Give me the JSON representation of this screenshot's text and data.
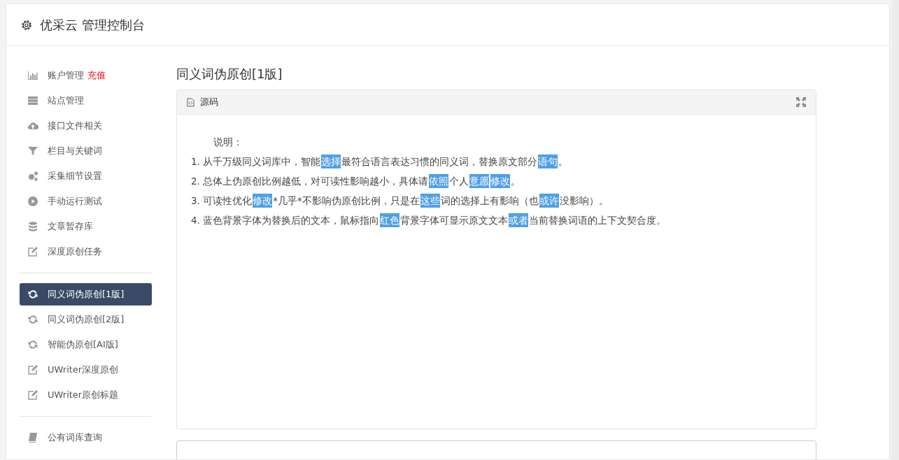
{
  "header": {
    "title": "优采云 管理控制台"
  },
  "sidebar": {
    "groups": [
      {
        "items": [
          {
            "label": "账户管理",
            "badge": "充值",
            "selected": false
          },
          {
            "label": "站点管理",
            "selected": false
          },
          {
            "label": "接口文件相关",
            "selected": false
          },
          {
            "label": "栏目与关键词",
            "selected": false
          },
          {
            "label": "采集细节设置",
            "selected": false
          },
          {
            "label": "手动运行测试",
            "selected": false
          },
          {
            "label": "文章暂存库",
            "selected": false
          },
          {
            "label": "深度原创任务",
            "selected": false
          }
        ]
      },
      {
        "items": [
          {
            "label": "同义词伪原创[1版]",
            "selected": true
          },
          {
            "label": "同义词伪原创[2版]",
            "selected": false
          },
          {
            "label": "智能伪原创[AI版]",
            "selected": false
          },
          {
            "label": "UWriter深度原创",
            "selected": false
          },
          {
            "label": "UWriter原创标题",
            "selected": false
          }
        ]
      },
      {
        "items": [
          {
            "label": "公有词库查询",
            "selected": false
          }
        ]
      }
    ]
  },
  "page_title": "同义词伪原创[1版]",
  "panel": {
    "title": "源码",
    "heading": "说明：",
    "lines": [
      [
        {
          "text": "1. 从千万级同义词库中，智能"
        },
        {
          "text": "选择",
          "highlight": true
        },
        {
          "text": "最符合语言表达习惯的同义词，替换原文部分"
        },
        {
          "text": "语句",
          "highlight": true
        },
        {
          "text": "。"
        }
      ],
      [
        {
          "text": "2. 总体上伪原创比例越低，对可读性影响越小，具体请"
        },
        {
          "text": "依照",
          "highlight": true
        },
        {
          "text": "个人"
        },
        {
          "text": "意愿",
          "highlight": true
        },
        {
          "text": "修改",
          "highlight": true
        },
        {
          "text": "。"
        }
      ],
      [
        {
          "text": "3. 可读性优化"
        },
        {
          "text": "修改",
          "highlight": true
        },
        {
          "text": "*几乎*不影响伪原创比例，只是在"
        },
        {
          "text": "这些",
          "highlight": true
        },
        {
          "text": "词的选择上有影响（也"
        },
        {
          "text": "或许",
          "highlight": true
        },
        {
          "text": "没影响）。"
        }
      ],
      [
        {
          "text": "4. 蓝色背景字体为替换后的文本，鼠标指向"
        },
        {
          "text": "红色",
          "highlight": true
        },
        {
          "text": "背景字体可显示原文文本"
        },
        {
          "text": "或者",
          "highlight": true
        },
        {
          "text": "当前替换词语的上下文契合度。"
        }
      ]
    ]
  }
}
